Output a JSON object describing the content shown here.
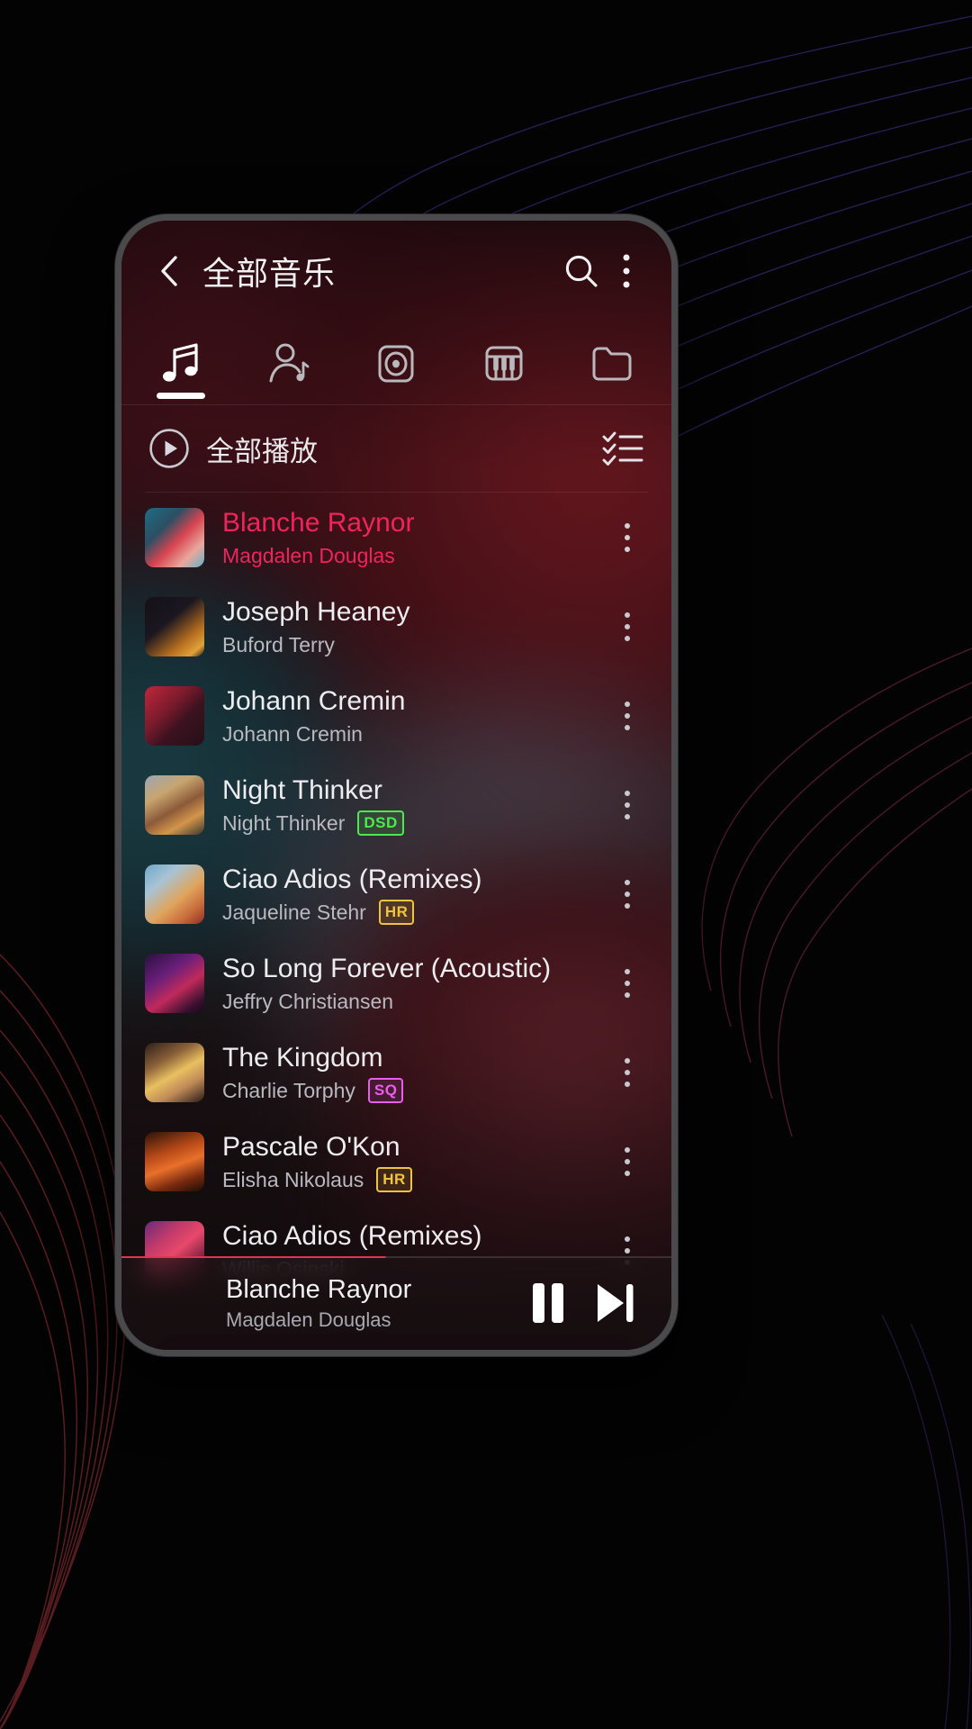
{
  "header": {
    "title": "全部音乐",
    "back_icon": "chevron-left-icon",
    "search_icon": "search-icon",
    "overflow_icon": "kebab-menu-icon"
  },
  "tabs": [
    {
      "name": "songs",
      "icon": "music-note-icon",
      "active": true
    },
    {
      "name": "artists",
      "icon": "artist-person-icon",
      "active": false
    },
    {
      "name": "albums",
      "icon": "album-disc-icon",
      "active": false
    },
    {
      "name": "genres",
      "icon": "piano-keys-icon",
      "active": false
    },
    {
      "name": "folders",
      "icon": "folder-icon",
      "active": false
    }
  ],
  "play_all": {
    "label": "全部播放",
    "play_icon": "play-circle-icon",
    "multiselect_icon": "checklist-icon"
  },
  "songs": [
    {
      "title": "Blanche Raynor",
      "artist": "Magdalen Douglas",
      "badge": "",
      "playing": true,
      "art": "linear-gradient(135deg,#1d6d86 0%,#2b4f63 32%,#d6444f 55%,#eaa79c 78%,#5fb3c9 100%)"
    },
    {
      "title": "Joseph Heaney",
      "artist": "Buford Terry",
      "badge": "",
      "playing": false,
      "art": "linear-gradient(140deg,#141116 0%,#1b1620 40%,#b9701f 72%,#e0a23a 88%,#2a1d12 100%)"
    },
    {
      "title": "Johann Cremin",
      "artist": "Johann Cremin",
      "badge": "",
      "playing": false,
      "art": "linear-gradient(135deg,#c0263a 0%,#7a1b2c 38%,#3b1220 62%,#241018 100%)"
    },
    {
      "title": "Night Thinker",
      "artist": "Night Thinker",
      "badge": "DSD",
      "playing": false,
      "art": "linear-gradient(150deg,#9ba7b5 0%,#c8a56f 30%,#8c5a3a 55%,#d3954a 75%,#3a3630 100%)"
    },
    {
      "title": "Ciao Adios (Remixes)",
      "artist": "Jaqueline Stehr",
      "badge": "HR",
      "playing": false,
      "art": "linear-gradient(140deg,#6fa8c8 0%,#a8c3d4 28%,#e0a45c 58%,#c76a3a 80%,#8a2f2a 100%)"
    },
    {
      "title": "So Long Forever (Acoustic)",
      "artist": "Jeffry Christiansen",
      "badge": "",
      "playing": false,
      "art": "linear-gradient(145deg,#2a1040 0%,#6a1f7a 35%,#c02a5a 60%,#3a1030 85%,#150818 100%)"
    },
    {
      "title": "The Kingdom",
      "artist": "Charlie Torphy",
      "badge": "SQ",
      "playing": false,
      "art": "linear-gradient(150deg,#2a1f1a 0%,#8a6038 30%,#e8c060 52%,#c08a58 72%,#2a1a14 100%)"
    },
    {
      "title": "Pascale O'Kon",
      "artist": "Elisha Nikolaus",
      "badge": "HR",
      "playing": false,
      "art": "linear-gradient(160deg,#2a1208 0%,#b84a18 35%,#e8702a 55%,#7a2a10 78%,#1a0c06 100%)"
    },
    {
      "title": "Ciao Adios (Remixes)",
      "artist": "Willis Osinski",
      "badge": "",
      "playing": false,
      "art": "linear-gradient(140deg,#6a2a7a 0%,#c03a6a 30%,#e8486a 52%,#7a2040 78%,#201018 100%)"
    }
  ],
  "mini_player": {
    "title": "Blanche Raynor",
    "artist": "Magdalen Douglas",
    "art": "linear-gradient(135deg,#1d6d86 0%,#2b4f63 32%,#d6444f 55%,#eaa79c 78%,#5fb3c9 100%)",
    "pause_icon": "pause-icon",
    "next_icon": "skip-next-icon",
    "progress_percent": 48
  },
  "colors": {
    "accent": "#f0245c",
    "badge_dsd": "#4dea4d",
    "badge_hr": "#f2c33c",
    "badge_sq": "#e95fe9",
    "text_primary": "#ededf0",
    "text_secondary": "#b9b9bf"
  }
}
